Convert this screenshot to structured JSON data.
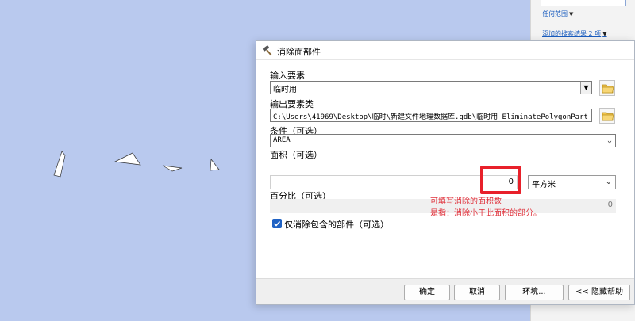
{
  "side_panel": {
    "link1": "任何范围",
    "link2": "添加的搜索结果 2 项"
  },
  "dialog": {
    "title": "消除面部件",
    "input_features": {
      "label": "输入要素",
      "value": "临时用"
    },
    "output_feature_class": {
      "label": "输出要素类",
      "value": "C:\\Users\\41969\\Desktop\\临时\\新建文件地理数据库.gdb\\临时用_EliminatePolygonPart"
    },
    "condition": {
      "label": "条件（可选）",
      "value": "AREA"
    },
    "area": {
      "label": "面积（可选）",
      "value": "0",
      "unit": "平方米"
    },
    "percentage": {
      "label": "百分比（可选）",
      "value": "0"
    },
    "annotation": {
      "line1": "可填写消除的面积数",
      "line2": "是指：消除小于此面积的部分。"
    },
    "checkbox": {
      "label": "仅消除包含的部件（可选）",
      "checked": true
    },
    "buttons": {
      "ok": "确定",
      "cancel": "取消",
      "env": "环境...",
      "help": "<< 隐藏帮助"
    }
  }
}
